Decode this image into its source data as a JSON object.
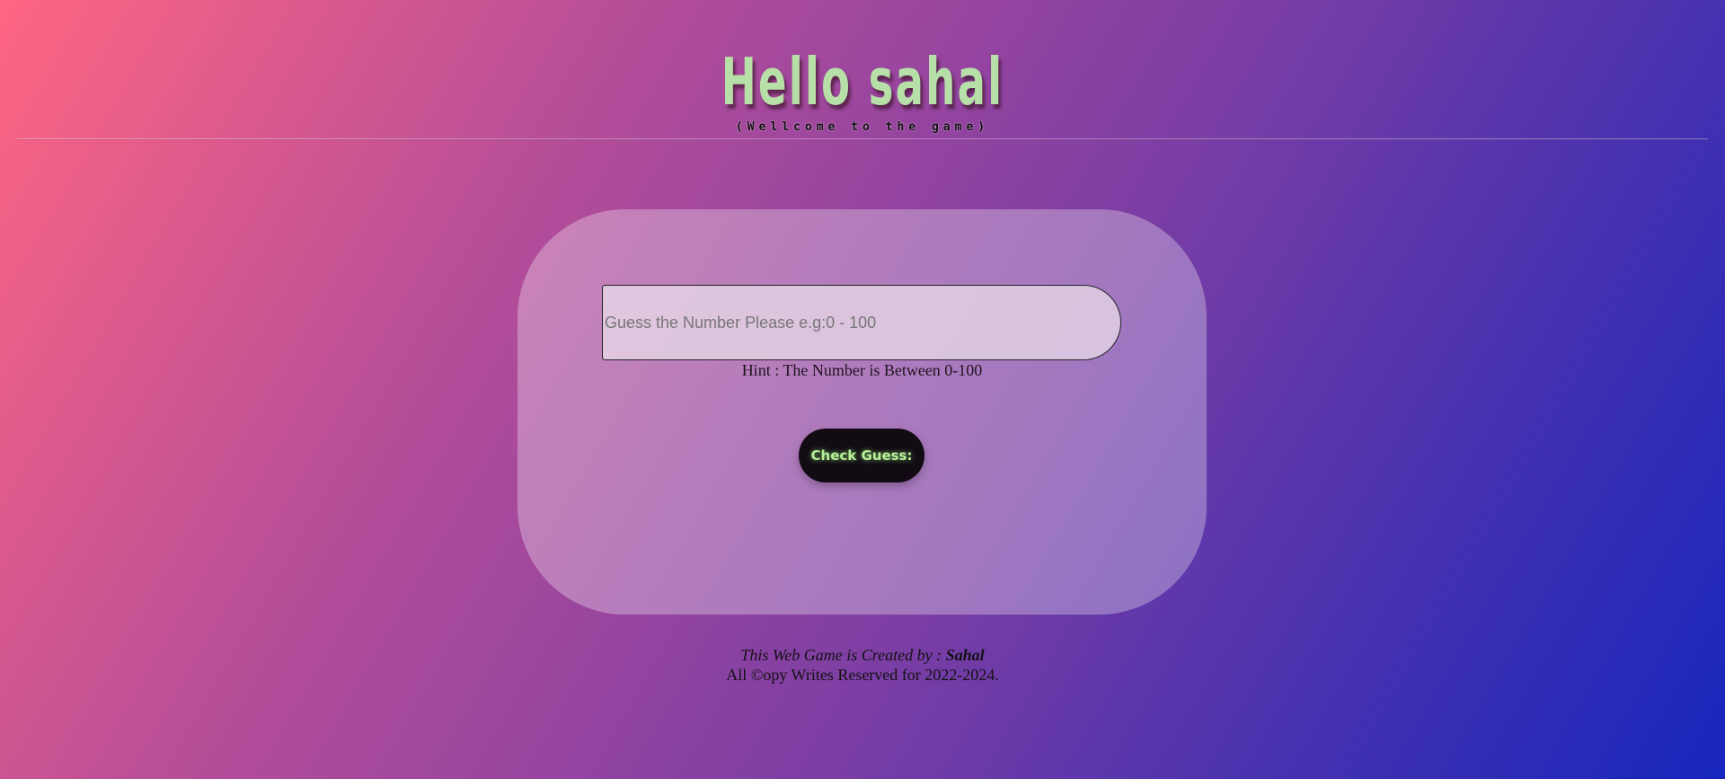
{
  "header": {
    "title": "Hello  sahal",
    "subtitle": "(Wellcome to the game)"
  },
  "game": {
    "input": {
      "placeholder": "Guess the Number Please e.g:0 - 100",
      "value": ""
    },
    "hint": "Hint : The Number is Between 0-100",
    "check_button_label": "Check Guess:"
  },
  "footer": {
    "credit_prefix": "This Web Game is Created by : ",
    "author": "Sahal",
    "copyright": "All ©opy Writes Reserved for 2022-2024."
  },
  "colors": {
    "background_start": "#ff6682",
    "background_end": "#1626bd",
    "title_color": "#b6e0a8",
    "button_bg": "#120b14",
    "button_text": "#b7ef9a"
  }
}
